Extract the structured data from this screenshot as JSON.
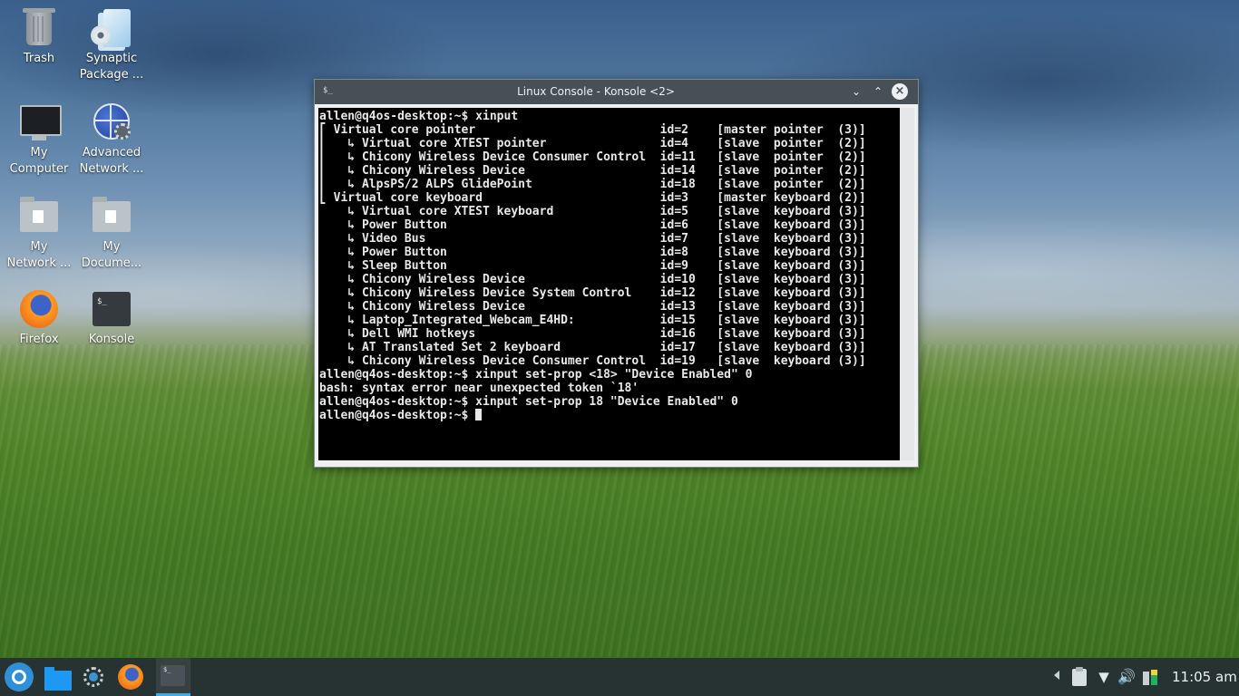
{
  "desktop": {
    "icons": [
      {
        "label": "Trash"
      },
      {
        "label": "Synaptic\nPackage ..."
      },
      {
        "label": "My\nComputer"
      },
      {
        "label": "Advanced\nNetwork ..."
      },
      {
        "label": "My\nNetwork ..."
      },
      {
        "label": "My\nDocume..."
      },
      {
        "label": "Firefox"
      },
      {
        "label": "Konsole"
      }
    ]
  },
  "window": {
    "title": "Linux Console - Konsole <2>",
    "icon_text": "$_",
    "buttons": {
      "minimize": "⌄",
      "maximize": "⌃",
      "close": "×"
    }
  },
  "terminal": {
    "lines": [
      "allen@q4os-desktop:~$ xinput",
      "⎡ Virtual core pointer                    \tid=2\t[master pointer  (3)]",
      "⎜   ↳ Virtual core XTEST pointer              \tid=4\t[slave  pointer  (2)]",
      "⎜   ↳ Chicony Wireless Device Consumer Control\tid=11\t[slave  pointer  (2)]",
      "⎜   ↳ Chicony Wireless Device                 \tid=14\t[slave  pointer  (2)]",
      "⎜   ↳ AlpsPS/2 ALPS GlidePoint                \tid=18\t[slave  pointer  (2)]",
      "⎣ Virtual core keyboard                   \tid=3\t[master keyboard (2)]",
      "    ↳ Virtual core XTEST keyboard             \tid=5\t[slave  keyboard (3)]",
      "    ↳ Power Button                            \tid=6\t[slave  keyboard (3)]",
      "    ↳ Video Bus                               \tid=7\t[slave  keyboard (3)]",
      "    ↳ Power Button                            \tid=8\t[slave  keyboard (3)]",
      "    ↳ Sleep Button                            \tid=9\t[slave  keyboard (3)]",
      "    ↳ Chicony Wireless Device                 \tid=10\t[slave  keyboard (3)]",
      "    ↳ Chicony Wireless Device System Control  \tid=12\t[slave  keyboard (3)]",
      "    ↳ Chicony Wireless Device                 \tid=13\t[slave  keyboard (3)]",
      "    ↳ Laptop_Integrated_Webcam_E4HD:          \tid=15\t[slave  keyboard (3)]",
      "    ↳ Dell WMI hotkeys                        \tid=16\t[slave  keyboard (3)]",
      "    ↳ AT Translated Set 2 keyboard            \tid=17\t[slave  keyboard (3)]",
      "    ↳ Chicony Wireless Device Consumer Control\tid=19\t[slave  keyboard (3)]",
      "allen@q4os-desktop:~$ xinput set-prop <18> \"Device Enabled\" 0",
      "bash: syntax error near unexpected token `18'",
      "allen@q4os-desktop:~$ xinput set-prop 18 \"Device Enabled\" 0"
    ],
    "prompt": "allen@q4os-desktop:~$ "
  },
  "taskbar": {
    "konsole_icon_text": "$_",
    "tray": {
      "wifi_glyph": "▼",
      "volume_glyph": "🔊"
    },
    "clock": "11:05 am"
  },
  "icons": {
    "trash": "trash-icon",
    "synaptic": "package-icon",
    "computer": "computer-icon",
    "network": "network-settings-icon",
    "folder": "folder-icon",
    "firefox": "firefox-icon",
    "konsole": "terminal-icon"
  },
  "colors": {
    "accent": "#3daee9",
    "titlebar": "#475057",
    "terminal_bg": "#000000"
  }
}
